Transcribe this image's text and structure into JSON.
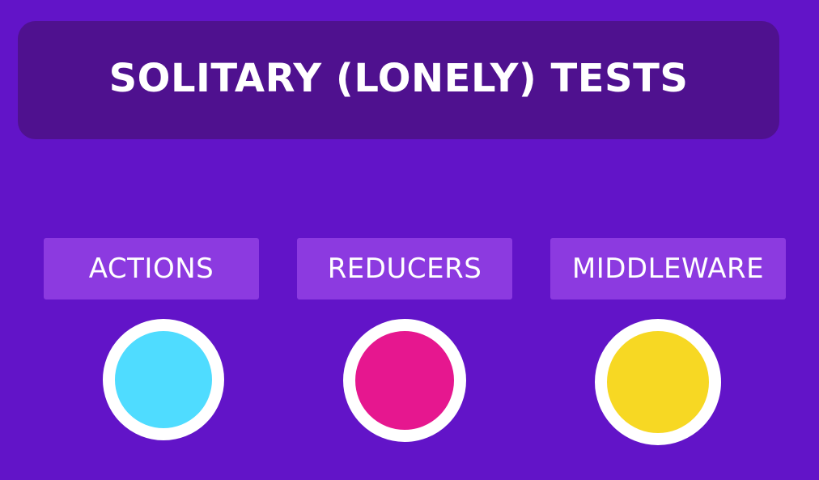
{
  "title": "SOLITARY (LONELY) TESTS",
  "colors": {
    "background": "#6214c8",
    "banner": "#4f118f",
    "label_box": "#8c3ae0",
    "ring": "#ffffff"
  },
  "items": [
    {
      "label": "ACTIONS",
      "color": "#4fdcff"
    },
    {
      "label": "REDUCERS",
      "color": "#e6178f"
    },
    {
      "label": "MIDDLEWARE",
      "color": "#f7d823"
    }
  ]
}
